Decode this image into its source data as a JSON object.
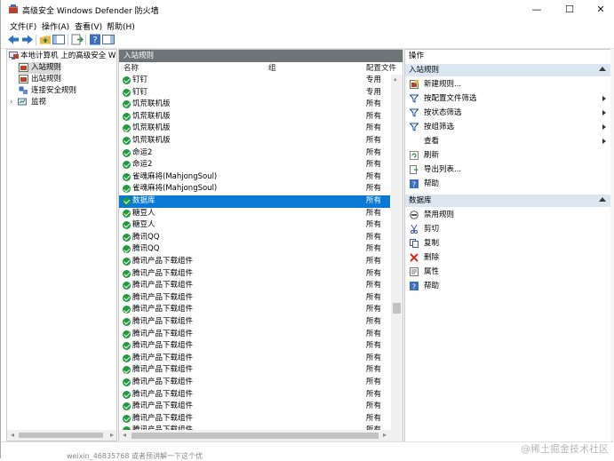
{
  "window": {
    "title": "高级安全 Windows Defender 防火墙",
    "minimize_icon": "—",
    "maximize_icon": "☐",
    "close_icon": "✕"
  },
  "menu": [
    "文件(F)",
    "操作(A)",
    "查看(V)",
    "帮助(H)"
  ],
  "tree": {
    "root": "本地计算机 上的高级安全 Windows Defender",
    "items": [
      "入站规则",
      "出站规则",
      "连接安全规则",
      "监视"
    ]
  },
  "center": {
    "header": "入站规则",
    "columns": {
      "name": "名称",
      "group": "组",
      "profile": "配置文件"
    },
    "rows": [
      {
        "name": "钉钉",
        "profile": "专用"
      },
      {
        "name": "钉钉",
        "profile": "专用"
      },
      {
        "name": "饥荒联机版",
        "profile": "所有"
      },
      {
        "name": "饥荒联机版",
        "profile": "所有"
      },
      {
        "name": "饥荒联机版",
        "profile": "所有"
      },
      {
        "name": "饥荒联机版",
        "profile": "所有"
      },
      {
        "name": "命运2",
        "profile": "所有"
      },
      {
        "name": "命运2",
        "profile": "所有"
      },
      {
        "name": "雀魂麻将(MahjongSoul)",
        "profile": "所有"
      },
      {
        "name": "雀魂麻将(MahjongSoul)",
        "profile": "所有"
      },
      {
        "name": "数据库",
        "profile": "所有",
        "selected": true
      },
      {
        "name": "糖豆人",
        "profile": "所有"
      },
      {
        "name": "糖豆人",
        "profile": "所有"
      },
      {
        "name": "腾讯QQ",
        "profile": "所有"
      },
      {
        "name": "腾讯QQ",
        "profile": "所有"
      },
      {
        "name": "腾讯产品下载组件",
        "profile": "所有"
      },
      {
        "name": "腾讯产品下载组件",
        "profile": "所有"
      },
      {
        "name": "腾讯产品下载组件",
        "profile": "所有"
      },
      {
        "name": "腾讯产品下载组件",
        "profile": "所有"
      },
      {
        "name": "腾讯产品下载组件",
        "profile": "所有"
      },
      {
        "name": "腾讯产品下载组件",
        "profile": "所有"
      },
      {
        "name": "腾讯产品下载组件",
        "profile": "所有"
      },
      {
        "name": "腾讯产品下载组件",
        "profile": "所有"
      },
      {
        "name": "腾讯产品下载组件",
        "profile": "所有"
      },
      {
        "name": "腾讯产品下载组件",
        "profile": "所有"
      },
      {
        "name": "腾讯产品下载组件",
        "profile": "所有"
      },
      {
        "name": "腾讯产品下载组件",
        "profile": "所有"
      },
      {
        "name": "腾讯产品下载组件",
        "profile": "所有"
      },
      {
        "name": "腾讯产品下载组件",
        "profile": "所有"
      },
      {
        "name": "腾讯产品下载组件",
        "profile": "所有"
      }
    ]
  },
  "actions": {
    "title": "操作",
    "section1": {
      "label": "入站规则",
      "items": [
        {
          "label": "新建规则...",
          "icon": "new-rule-icon",
          "submenu": false
        },
        {
          "label": "按配置文件筛选",
          "icon": "filter-icon",
          "submenu": true
        },
        {
          "label": "按状态筛选",
          "icon": "filter-icon",
          "submenu": true
        },
        {
          "label": "按组筛选",
          "icon": "filter-icon",
          "submenu": true
        },
        {
          "label": "查看",
          "icon": "",
          "submenu": true
        },
        {
          "label": "刷新",
          "icon": "refresh-icon",
          "submenu": false
        },
        {
          "label": "导出列表...",
          "icon": "export-icon",
          "submenu": false
        },
        {
          "label": "帮助",
          "icon": "help-icon",
          "submenu": false
        }
      ]
    },
    "section2": {
      "label": "数据库",
      "items": [
        {
          "label": "禁用规则",
          "icon": "disable-icon"
        },
        {
          "label": "剪切",
          "icon": "cut-icon"
        },
        {
          "label": "复制",
          "icon": "copy-icon"
        },
        {
          "label": "删除",
          "icon": "delete-icon"
        },
        {
          "label": "属性",
          "icon": "properties-icon"
        },
        {
          "label": "帮助",
          "icon": "help-icon"
        }
      ]
    }
  },
  "watermark": "@稀土掘金技术社区",
  "behind_text": "weixin_46835768 或者预讲解一下这个优"
}
